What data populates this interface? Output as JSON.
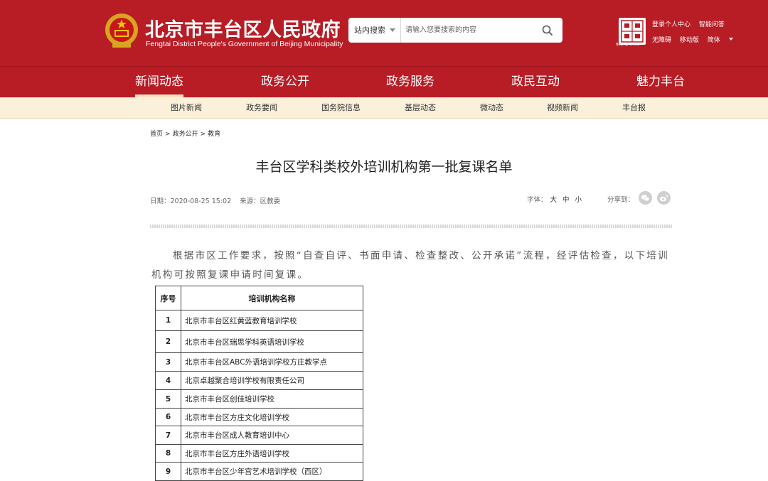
{
  "header": {
    "title": "北京市丰台区人民政府",
    "subtitle": "Fengtai District People's Government of Beijing Municipality",
    "emblem_icon": "national-emblem-icon",
    "logo_caption": "Beijing-China",
    "brand_color": "#b81c25"
  },
  "search": {
    "scope_label": "站内搜索",
    "placeholder": "请输入您要搜索的内容",
    "button_icon": "search-icon"
  },
  "top_links": {
    "row1": [
      "登录个人中心",
      "智能问答"
    ],
    "row2": [
      "无障碍",
      "移动版",
      "简体"
    ]
  },
  "main_nav": {
    "items": [
      "新闻动态",
      "政务公开",
      "政务服务",
      "政民互动",
      "魅力丰台"
    ],
    "active": "新闻动态"
  },
  "sub_nav": {
    "items": [
      "图片新闻",
      "政务要闻",
      "国务院信息",
      "基层动态",
      "微动态",
      "视频新闻",
      "丰台报"
    ],
    "background": "#fbf0da"
  },
  "breadcrumb": {
    "items": [
      "首页",
      "政务公开",
      "教育"
    ],
    "separator": ">"
  },
  "article": {
    "title": "丰台区学科类校外培训机构第一批复课名单",
    "date_label": "日期：",
    "date": "2020-08-25 15:02",
    "source_label": "来源：",
    "source": "区教委",
    "font_size_label": "字体：",
    "font_size_options": [
      "大",
      "中",
      "小"
    ],
    "share_label": "分享到：",
    "share_icons": [
      "wechat-icon",
      "weibo-icon"
    ],
    "paragraph": "根据市区工作要求，按照“自查自评、书面申请、检查整改、公开承诺”流程，经评估检查，以下培训机构可按照复课申请时间复课。"
  },
  "table": {
    "headers": [
      "序号",
      "培训机构名称"
    ],
    "rows": [
      [
        "1",
        "北京市丰台区红黄蓝教育培训学校"
      ],
      [
        "2",
        "北京市丰台区瑞思学科英语培训学校"
      ],
      [
        "3",
        "北京市丰台区ABC外语培训学校方庄教学点"
      ],
      [
        "4",
        "北京卓越聚合培训学校有限责任公司"
      ],
      [
        "5",
        "北京市丰台区创佳培训学校"
      ],
      [
        "6",
        "北京市丰台区方庄文化培训学校"
      ],
      [
        "7",
        "北京市丰台区成人教育培训中心"
      ],
      [
        "8",
        "北京市丰台区方庄外语培训学校"
      ],
      [
        "9",
        "北京市丰台区少年宫艺术培训学校（西区）"
      ]
    ]
  }
}
